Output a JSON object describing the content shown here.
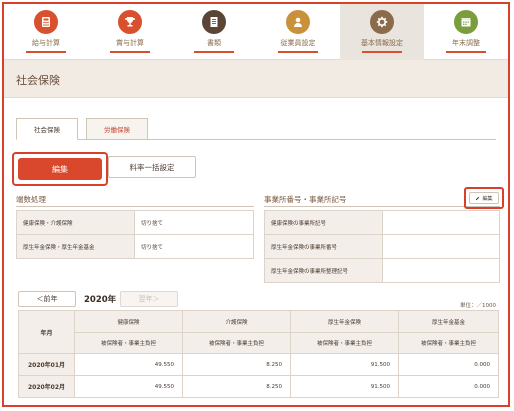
{
  "nav": {
    "items": [
      {
        "label": "給与計算",
        "color": "#d9502e",
        "underline": "#d9502e",
        "icon": "calculator-icon",
        "active": false
      },
      {
        "label": "賞与計算",
        "color": "#d9502e",
        "underline": "#d9502e",
        "icon": "trophy-icon",
        "active": false
      },
      {
        "label": "書類",
        "color": "#5a4536",
        "underline": "#d9502e",
        "icon": "document-icon",
        "active": false
      },
      {
        "label": "従業員設定",
        "color": "#c8913a",
        "underline": "#d9502e",
        "icon": "person-icon",
        "active": false
      },
      {
        "label": "基本情報設定",
        "color": "#8a6b4a",
        "underline": "#d9502e",
        "icon": "gear-icon",
        "active": true
      },
      {
        "label": "年末調整",
        "color": "#7a9e3e",
        "underline": "#d9502e",
        "icon": "calendar-icon",
        "active": false
      }
    ]
  },
  "page": {
    "title": "社会保険"
  },
  "tabs": {
    "social": "社会保険",
    "labor": "労働保険"
  },
  "actions": {
    "edit": "編集",
    "batch": "料率一括設定"
  },
  "rounding": {
    "title": "端数処理",
    "rows": [
      {
        "key": "健康保険・介護保険",
        "value": "切り捨て"
      },
      {
        "key": "厚生年金保険・厚生年金基金",
        "value": "切り捨て"
      }
    ]
  },
  "office": {
    "title": "事業所番号・事業所記号",
    "edit_label": "編集",
    "rows": [
      {
        "key": "健康保険の事業所記号",
        "value": ""
      },
      {
        "key": "厚生年金保険の事業所番号",
        "value": ""
      },
      {
        "key": "厚生年金保険の事業所整理記号",
        "value": ""
      }
    ]
  },
  "year_nav": {
    "prev": "＜前年",
    "year": "2020年",
    "next": "翌年＞",
    "unit": "単位：／1000"
  },
  "monthly_table": {
    "month_header": "年月",
    "groups": [
      "健康保険",
      "介護保険",
      "厚生年金保険",
      "厚生年金基金"
    ],
    "sub": [
      "被保険者・事業主負担",
      "被保険者・事業主負担",
      "被保険者・事業主負担",
      "被保険者・事業主負担"
    ],
    "rows": [
      {
        "month": "2020年01月",
        "values": [
          "49.550",
          "8.250",
          "91.500",
          "0.000"
        ]
      },
      {
        "month": "2020年02月",
        "values": [
          "49.550",
          "8.250",
          "91.500",
          "0.000"
        ]
      }
    ]
  }
}
